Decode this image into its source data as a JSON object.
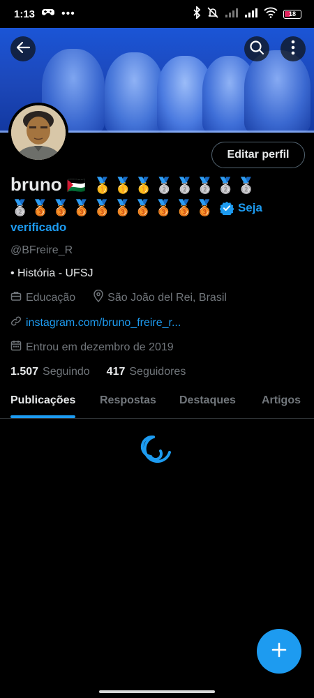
{
  "status_bar": {
    "time": "1:13",
    "battery": "18",
    "icons": [
      "game-controller-icon",
      "more-dots-icon",
      "bluetooth-icon",
      "mute-icon",
      "signal-icon",
      "signal-icon",
      "wifi-icon",
      "battery-icon"
    ]
  },
  "header": {
    "back_icon": "arrow-left-icon",
    "search_icon": "search-icon",
    "more_icon": "more-vertical-icon"
  },
  "profile": {
    "name": "bruno",
    "name_emojis": "🇵🇸 🥇🥇🥇🥈🥈🥈🥈🥈",
    "medals_line2": "🥈🥉🥉🥉🥉🥉🥉🥉🥉🥉",
    "verify_cta_part1": "Seja",
    "verify_cta_part2": "verificado",
    "handle": "@BFreire_R",
    "bio": "• História - UFSJ",
    "category": "Educação",
    "location": "São João del Rei, Brasil",
    "link": "instagram.com/bruno_freire_r...",
    "joined": "Entrou em dezembro de 2019",
    "following_count": "1.507",
    "following_label": "Seguindo",
    "followers_count": "417",
    "followers_label": "Seguidores",
    "edit_button": "Editar perfil"
  },
  "tabs": [
    {
      "label": "Publicações",
      "active": true
    },
    {
      "label": "Respostas",
      "active": false
    },
    {
      "label": "Destaques",
      "active": false
    },
    {
      "label": "Artigos",
      "active": false
    }
  ],
  "colors": {
    "accent": "#1d9bf0",
    "background": "#000000",
    "secondary_text": "#71767b",
    "banner": "#1c47b8"
  },
  "fab_icon": "plus-icon"
}
